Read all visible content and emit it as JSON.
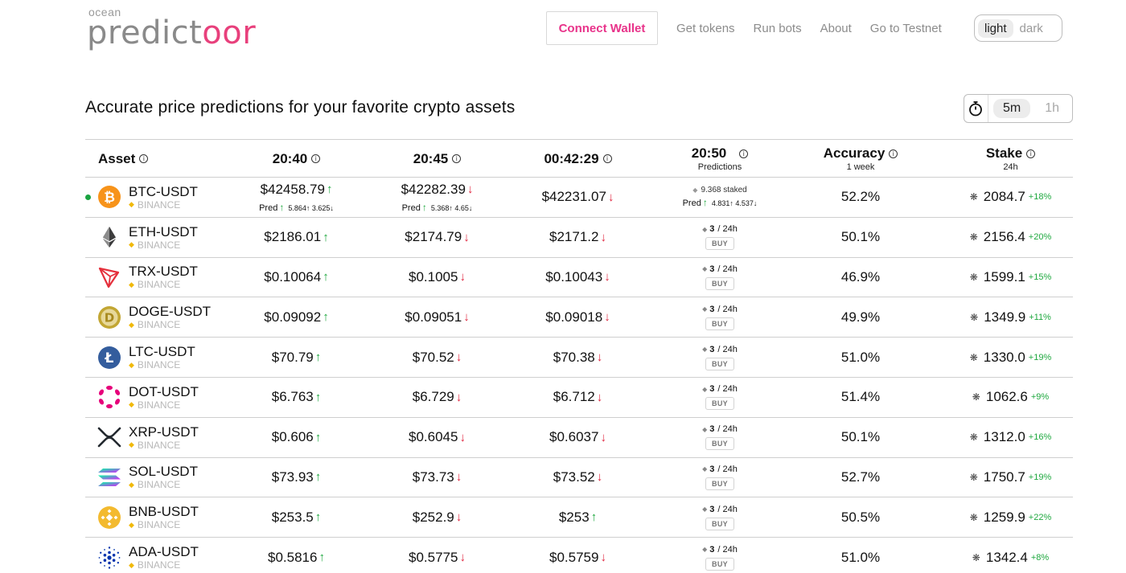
{
  "header": {
    "logo_small": "ocean",
    "logo_main_a": "predict",
    "logo_main_b": "oor",
    "connect_label": "Connect Wallet",
    "nav": [
      "Get tokens",
      "Run bots",
      "About",
      "Go to Testnet"
    ],
    "theme_light": "light",
    "theme_dark": "dark"
  },
  "title": "Accurate price predictions for your favorite crypto assets",
  "interval": {
    "opt1": "5m",
    "opt2": "1h",
    "selected": "5m"
  },
  "columns": {
    "asset": "Asset",
    "t1": "20:40",
    "t2": "20:45",
    "t3": "00:42:29",
    "t4": "20:50",
    "t4_sub": "Predictions",
    "accuracy": "Accuracy",
    "accuracy_sub": "1 week",
    "stake": "Stake",
    "stake_sub": "24h"
  },
  "colors": {
    "accent_pink": "#e8338a",
    "up_green": "#1fa83f",
    "down_red": "#e0263f"
  },
  "rows": [
    {
      "pair": "BTC-USDT",
      "exchange": "BINANCE",
      "icon": "bitcoin-icon",
      "p1": "$42458.79",
      "p1_dir": "↑",
      "p1_pred": "Pred",
      "p1_pred_dir": "↑",
      "p1_pred_vals": "5.864↑ 3.625↓",
      "p2": "$42282.39",
      "p2_dir": "↓",
      "p2_pred": "Pred",
      "p2_pred_dir": "↑",
      "p2_pred_vals": "5.368↑ 4.65↓",
      "p3": "$42231.07",
      "p3_dir": "↓",
      "staked": "9.368 staked",
      "p4_pred": "Pred",
      "p4_pred_dir": "↑",
      "p4_pred_vals": "4.831↑ 4.537↓",
      "accuracy": "52.2%",
      "stake": "2084.7",
      "stake_change": "+18%",
      "active": true
    },
    {
      "pair": "ETH-USDT",
      "exchange": "BINANCE",
      "icon": "ethereum-icon",
      "p1": "$2186.01",
      "p1_dir": "↑",
      "p2": "$2174.79",
      "p2_dir": "↓",
      "p3": "$2171.2",
      "p3_dir": "↓",
      "subs": "3",
      "subs_period": "/ 24h",
      "buy": "BUY",
      "accuracy": "50.1%",
      "stake": "2156.4",
      "stake_change": "+20%"
    },
    {
      "pair": "TRX-USDT",
      "exchange": "BINANCE",
      "icon": "tron-icon",
      "p1": "$0.10064",
      "p1_dir": "↑",
      "p2": "$0.1005",
      "p2_dir": "↓",
      "p3": "$0.10043",
      "p3_dir": "↓",
      "subs": "3",
      "subs_period": "/ 24h",
      "buy": "BUY",
      "accuracy": "46.9%",
      "stake": "1599.1",
      "stake_change": "+15%"
    },
    {
      "pair": "DOGE-USDT",
      "exchange": "BINANCE",
      "icon": "dogecoin-icon",
      "p1": "$0.09092",
      "p1_dir": "↑",
      "p2": "$0.09051",
      "p2_dir": "↓",
      "p3": "$0.09018",
      "p3_dir": "↓",
      "subs": "3",
      "subs_period": "/ 24h",
      "buy": "BUY",
      "accuracy": "49.9%",
      "stake": "1349.9",
      "stake_change": "+11%"
    },
    {
      "pair": "LTC-USDT",
      "exchange": "BINANCE",
      "icon": "litecoin-icon",
      "p1": "$70.79",
      "p1_dir": "↑",
      "p2": "$70.52",
      "p2_dir": "↓",
      "p3": "$70.38",
      "p3_dir": "↓",
      "subs": "3",
      "subs_period": "/ 24h",
      "buy": "BUY",
      "accuracy": "51.0%",
      "stake": "1330.0",
      "stake_change": "+19%"
    },
    {
      "pair": "DOT-USDT",
      "exchange": "BINANCE",
      "icon": "polkadot-icon",
      "p1": "$6.763",
      "p1_dir": "↑",
      "p2": "$6.729",
      "p2_dir": "↓",
      "p3": "$6.712",
      "p3_dir": "↓",
      "subs": "3",
      "subs_period": "/ 24h",
      "buy": "BUY",
      "accuracy": "51.4%",
      "stake": "1062.6",
      "stake_change": "+9%"
    },
    {
      "pair": "XRP-USDT",
      "exchange": "BINANCE",
      "icon": "xrp-icon",
      "p1": "$0.606",
      "p1_dir": "↑",
      "p2": "$0.6045",
      "p2_dir": "↓",
      "p3": "$0.6037",
      "p3_dir": "↓",
      "subs": "3",
      "subs_period": "/ 24h",
      "buy": "BUY",
      "accuracy": "50.1%",
      "stake": "1312.0",
      "stake_change": "+16%"
    },
    {
      "pair": "SOL-USDT",
      "exchange": "BINANCE",
      "icon": "solana-icon",
      "p1": "$73.93",
      "p1_dir": "↑",
      "p2": "$73.73",
      "p2_dir": "↓",
      "p3": "$73.52",
      "p3_dir": "↓",
      "subs": "3",
      "subs_period": "/ 24h",
      "buy": "BUY",
      "accuracy": "52.7%",
      "stake": "1750.7",
      "stake_change": "+19%"
    },
    {
      "pair": "BNB-USDT",
      "exchange": "BINANCE",
      "icon": "bnb-icon",
      "p1": "$253.5",
      "p1_dir": "↑",
      "p2": "$252.9",
      "p2_dir": "↓",
      "p3": "$253",
      "p3_dir": "↑",
      "subs": "3",
      "subs_period": "/ 24h",
      "buy": "BUY",
      "accuracy": "50.5%",
      "stake": "1259.9",
      "stake_change": "+22%"
    },
    {
      "pair": "ADA-USDT",
      "exchange": "BINANCE",
      "icon": "cardano-icon",
      "p1": "$0.5816",
      "p1_dir": "↑",
      "p2": "$0.5775",
      "p2_dir": "↓",
      "p3": "$0.5759",
      "p3_dir": "↓",
      "subs": "3",
      "subs_period": "/ 24h",
      "buy": "BUY",
      "accuracy": "51.0%",
      "stake": "1342.4",
      "stake_change": "+8%"
    }
  ]
}
